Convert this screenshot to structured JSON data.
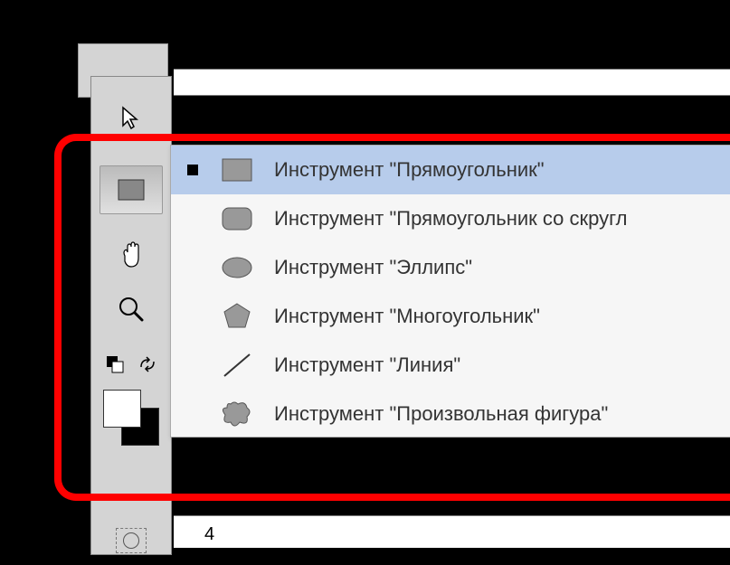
{
  "flyout": {
    "items": [
      {
        "label": "Инструмент \"Прямоугольник\"",
        "selected": true,
        "icon": "rectangle"
      },
      {
        "label": "Инструмент \"Прямоугольник со скругл",
        "selected": false,
        "icon": "rounded-rectangle"
      },
      {
        "label": "Инструмент \"Эллипс\"",
        "selected": false,
        "icon": "ellipse"
      },
      {
        "label": "Инструмент \"Многоугольник\"",
        "selected": false,
        "icon": "polygon"
      },
      {
        "label": "Инструмент \"Линия\"",
        "selected": false,
        "icon": "line"
      },
      {
        "label": "Инструмент \"Произвольная фигура\"",
        "selected": false,
        "icon": "custom-shape"
      }
    ]
  },
  "ruler": {
    "tick": "4"
  }
}
